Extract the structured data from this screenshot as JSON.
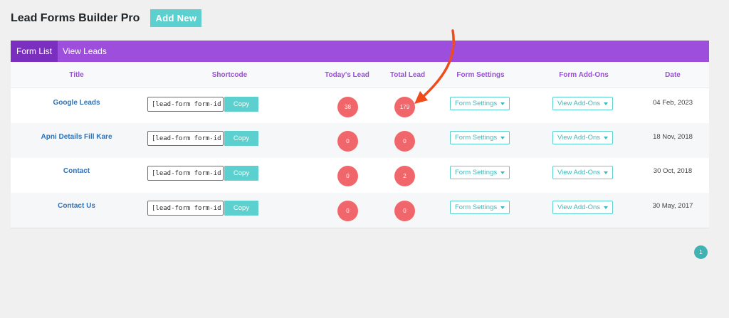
{
  "header": {
    "title": "Lead Forms Builder Pro",
    "add_new_label": "Add New"
  },
  "tabs": [
    {
      "label": "Form List",
      "active": true
    },
    {
      "label": "View Leads",
      "active": false
    }
  ],
  "columns": [
    "Title",
    "Shortcode",
    "Today's Lead",
    "Total Lead",
    "Form Settings",
    "Form Add-Ons",
    "Date"
  ],
  "rows": [
    {
      "title": "Google Leads",
      "shortcode": "[lead-form form-id",
      "copy_label": "Copy",
      "today": "38",
      "total": "179",
      "settings_label": "Form Settings",
      "addons_label": "View Add-Ons",
      "date": "04 Feb, 2023"
    },
    {
      "title": "Apni Details Fill Kare",
      "shortcode": "[lead-form form-id",
      "copy_label": "Copy",
      "today": "0",
      "total": "0",
      "settings_label": "Form Settings",
      "addons_label": "View Add-Ons",
      "date": "18 Nov, 2018"
    },
    {
      "title": "Contact",
      "shortcode": "[lead-form form-id",
      "copy_label": "Copy",
      "today": "0",
      "total": "2",
      "settings_label": "Form Settings",
      "addons_label": "View Add-Ons",
      "date": "30 Oct, 2018"
    },
    {
      "title": "Contact Us",
      "shortcode": "[lead-form form-id",
      "copy_label": "Copy",
      "today": "0",
      "total": "0",
      "settings_label": "Form Settings",
      "addons_label": "View Add-Ons",
      "date": "30 May, 2017"
    }
  ],
  "pagination": {
    "current": "1"
  },
  "colors": {
    "accent": "#9d4edd",
    "teal": "#5ccfcf",
    "badge": "#f0666a",
    "annotation_arrow": "#f24b1a"
  },
  "annotation": {
    "icon": "red-arrow-icon"
  }
}
